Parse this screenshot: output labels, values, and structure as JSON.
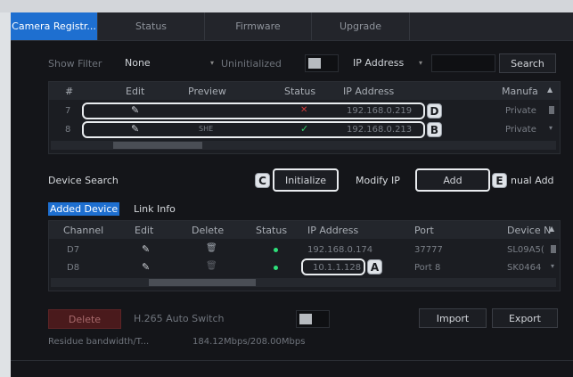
{
  "tabs": [
    "Camera Registr...",
    "Status",
    "Firmware",
    "Upgrade"
  ],
  "filter": {
    "show_filter_label": "Show Filter",
    "show_filter_value": "None",
    "uninitialized_label": "Uninitialized",
    "ip_select": "IP Address",
    "search_label": "Search"
  },
  "top_table": {
    "headers": [
      "#",
      "Edit",
      "Preview",
      "Status",
      "IP Address",
      "Manufa"
    ],
    "rows": [
      {
        "num": "7",
        "preview": "",
        "status": "x",
        "ip": "192.168.0.219",
        "manu": "Private"
      },
      {
        "num": "8",
        "preview": "SHE",
        "status": "check",
        "ip": "192.168.0.213",
        "manu": "Private"
      }
    ]
  },
  "search_bar": {
    "device_search": "Device Search",
    "initialize": "Initialize",
    "modify_ip": "Modify IP",
    "add": "Add",
    "manual_add": "nual Add"
  },
  "subtabs": [
    "Added Device",
    "Link Info"
  ],
  "added_table": {
    "headers": [
      "Channel",
      "Edit",
      "Delete",
      "Status",
      "IP Address",
      "Port",
      "Device N"
    ],
    "rows": [
      {
        "channel": "D7",
        "ip": "192.168.0.174",
        "port": "37777",
        "device": "SL09A5("
      },
      {
        "channel": "D8",
        "ip": "10.1.1.128",
        "port": "Port 8",
        "device": "SK0464"
      }
    ]
  },
  "bottom": {
    "delete": "Delete",
    "h265": "H.265 Auto Switch",
    "import": "Import",
    "export": "Export",
    "residue_label": "Residue bandwidth/T...",
    "residue_value": "184.12Mbps/208.00Mbps"
  },
  "callouts": [
    "A",
    "B",
    "C",
    "D",
    "E"
  ],
  "colors": {
    "accent": "#1e6fd0",
    "status_ok": "#2ee07a",
    "status_err": "#d43a3a"
  }
}
